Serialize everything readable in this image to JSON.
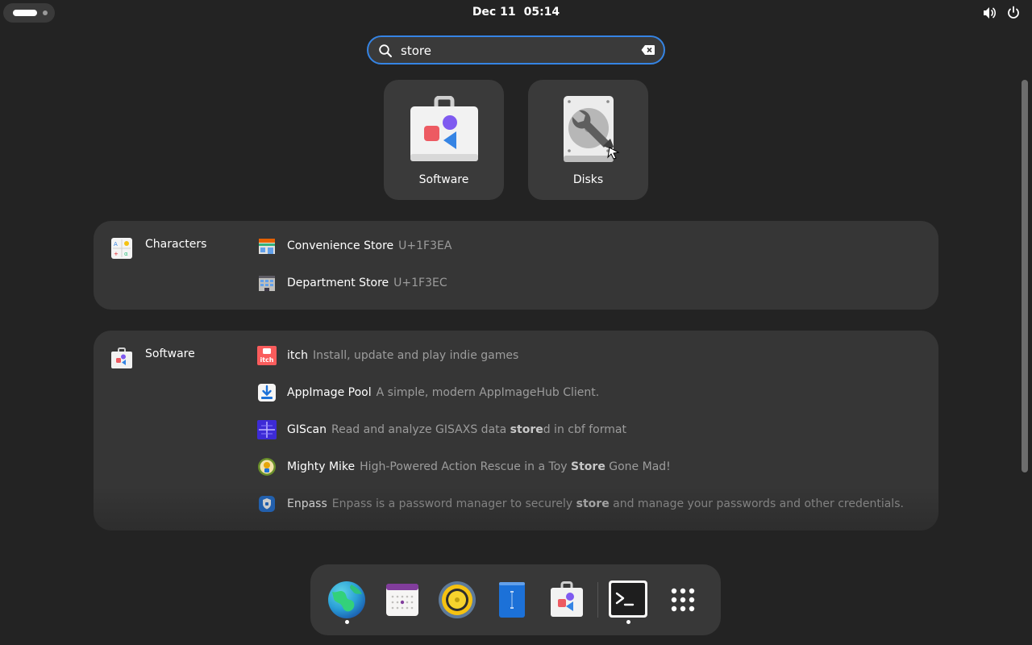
{
  "topbar": {
    "date": "Dec 11",
    "time": "05:14",
    "tray_icons": [
      "volume-icon",
      "power-icon"
    ]
  },
  "search": {
    "value": "store"
  },
  "app_results": [
    {
      "label": "Software",
      "icon": "software-store-icon"
    },
    {
      "label": "Disks",
      "icon": "disks-icon"
    }
  ],
  "providers": {
    "characters": {
      "name": "Characters",
      "results": [
        {
          "title": "Convenience Store",
          "desc": "U+1F3EA",
          "icon": "convenience-store-icon"
        },
        {
          "title": "Department Store",
          "desc": "U+1F3EC",
          "icon": "department-store-icon"
        }
      ]
    },
    "software": {
      "name": "Software",
      "results": [
        {
          "title": "itch",
          "desc_before": "Install, update and play indie games",
          "desc_bold": "",
          "desc_after": "",
          "icon": "itch-icon"
        },
        {
          "title": "AppImage Pool",
          "desc_before": "A simple, modern AppImageHub Client.",
          "desc_bold": "",
          "desc_after": "",
          "icon": "appimage-pool-icon"
        },
        {
          "title": "GIScan",
          "desc_before": "Read and analyze GISAXS data ",
          "desc_bold": "store",
          "desc_after": "d in cbf format",
          "icon": "giscan-icon"
        },
        {
          "title": "Mighty Mike",
          "desc_before": "High-Powered Action Rescue in a Toy ",
          "desc_bold": "Store",
          "desc_after": " Gone Mad!",
          "icon": "mighty-mike-icon"
        },
        {
          "title": "Enpass",
          "desc_before": "Enpass is a password manager to securely ",
          "desc_bold": "store",
          "desc_after": " and manage your passwords and other credentials.",
          "icon": "enpass-icon"
        }
      ]
    }
  },
  "dock": {
    "items": [
      {
        "name": "browser",
        "icon": "browser-globe-icon",
        "running": true
      },
      {
        "name": "calendar",
        "icon": "calendar-icon",
        "running": false
      },
      {
        "name": "rhythmbox",
        "icon": "music-speaker-icon",
        "running": false
      },
      {
        "name": "text-editor",
        "icon": "text-editor-icon",
        "running": false
      },
      {
        "name": "software",
        "icon": "software-store-icon",
        "running": false
      },
      {
        "name": "terminal",
        "icon": "terminal-icon",
        "running": true
      },
      {
        "name": "app-grid",
        "icon": "app-grid-icon",
        "running": false
      }
    ]
  },
  "colors": {
    "background": "#232323",
    "accent": "#3584e4",
    "panel": "#363636"
  }
}
